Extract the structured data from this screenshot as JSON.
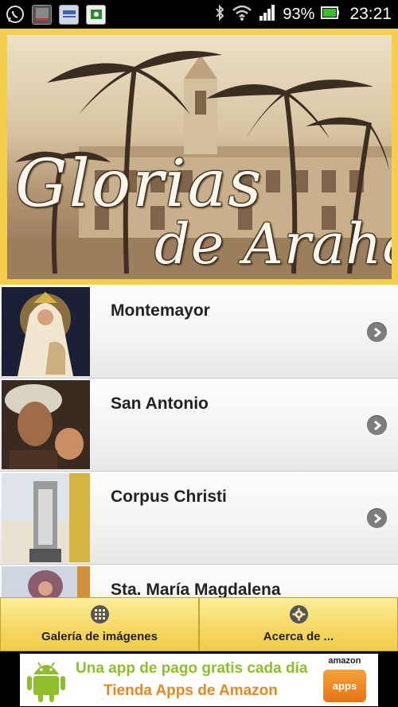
{
  "status_bar": {
    "battery_percent": "93%",
    "time": "23:21",
    "icons": [
      "whatsapp-icon",
      "gallery-thumb-icon",
      "news-thumb-icon",
      "app-thumb-icon",
      "bluetooth-icon",
      "wifi-icon",
      "signal-icon",
      "battery-icon"
    ]
  },
  "header": {
    "title_main": "Glorias",
    "title_sub": "de Arahal"
  },
  "list": {
    "items": [
      {
        "label": "Montemayor",
        "thumb": "virgin-montemayor-image"
      },
      {
        "label": "San Antonio",
        "thumb": "san-antonio-image"
      },
      {
        "label": "Corpus Christi",
        "thumb": "corpus-christi-image"
      },
      {
        "label": "Sta. María Magdalena",
        "thumb": "maria-magdalena-image"
      }
    ]
  },
  "tabs": [
    {
      "label": "Galería de imágenes",
      "icon": "grid-icon"
    },
    {
      "label": "Acerca de ...",
      "icon": "gear-icon"
    }
  ],
  "ad": {
    "line1": "Una app de pago gratis  cada día",
    "line2": "Tienda Apps de Amazon",
    "badge_top": "amazon",
    "badge_bottom": "apps",
    "colors": {
      "line1": "#8fbe2d",
      "line2": "#e8881c",
      "badge": "#e57414"
    }
  },
  "colors": {
    "accent_yellow": "#f4cf49",
    "status_bar": "#000000",
    "arrow": "#7d7d7d"
  }
}
